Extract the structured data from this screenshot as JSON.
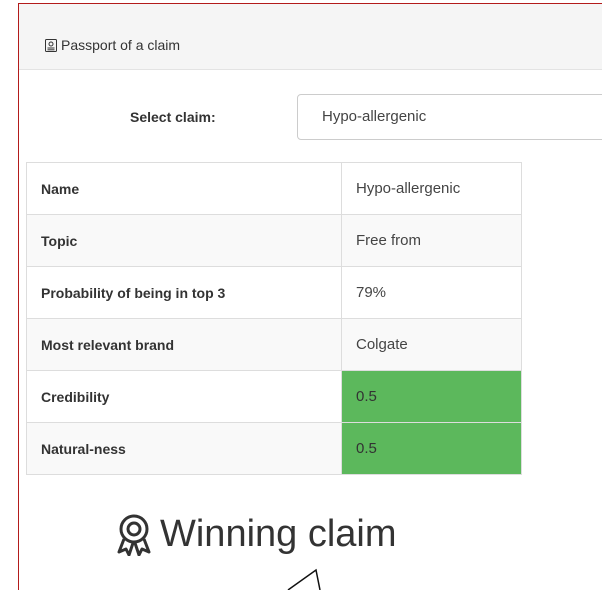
{
  "panel": {
    "title": "Passport of a claim",
    "title_icon": "id-card-icon"
  },
  "selector": {
    "label": "Select claim:",
    "value": "Hypo-allergenic"
  },
  "passport_table": {
    "rows": [
      {
        "key": "Name",
        "value": "Hypo-allergenic"
      },
      {
        "key": "Topic",
        "value": "Free from"
      },
      {
        "key": "Probability of being in top 3",
        "value": "79%"
      },
      {
        "key": "Most relevant brand",
        "value": "Colgate"
      },
      {
        "key": "Credibility",
        "value": "0.5"
      },
      {
        "key": "Natural-ness",
        "value": "0.5"
      }
    ]
  },
  "winning": {
    "text": "Winning claim",
    "icon": "award-ribbon-icon"
  },
  "colors": {
    "panel_border": "#b31b1b",
    "highlight_green": "#5cb85c",
    "heading_bg": "#f5f5f5"
  }
}
